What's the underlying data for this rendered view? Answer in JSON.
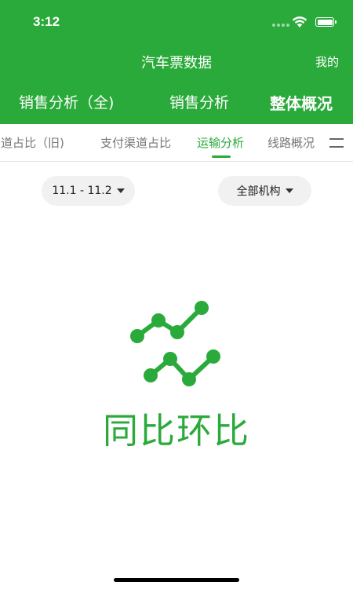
{
  "status_bar": {
    "time": "3:12"
  },
  "header": {
    "title": "汽车票数据",
    "right_link": "我的"
  },
  "main_tabs": [
    {
      "label": "销售分析（全)"
    },
    {
      "label": "销售分析"
    },
    {
      "label": "整体概况"
    }
  ],
  "sub_tabs": [
    {
      "label": "渠道占比（旧)"
    },
    {
      "label": "支付渠道占比"
    },
    {
      "label": "运输分析"
    },
    {
      "label": "线路概况"
    }
  ],
  "filters": {
    "date_range": "11.1 - 11.2",
    "organization": "全部机构"
  },
  "empty_state": {
    "text": "同比环比"
  },
  "colors": {
    "brand": "#2aaa3a",
    "tab_active": "#2aaa3a",
    "tab_inactive": "#777777"
  },
  "icons": [
    "wifi-icon",
    "battery-icon",
    "menu-icon",
    "caret-down-icon",
    "trend-chart-icon"
  ]
}
